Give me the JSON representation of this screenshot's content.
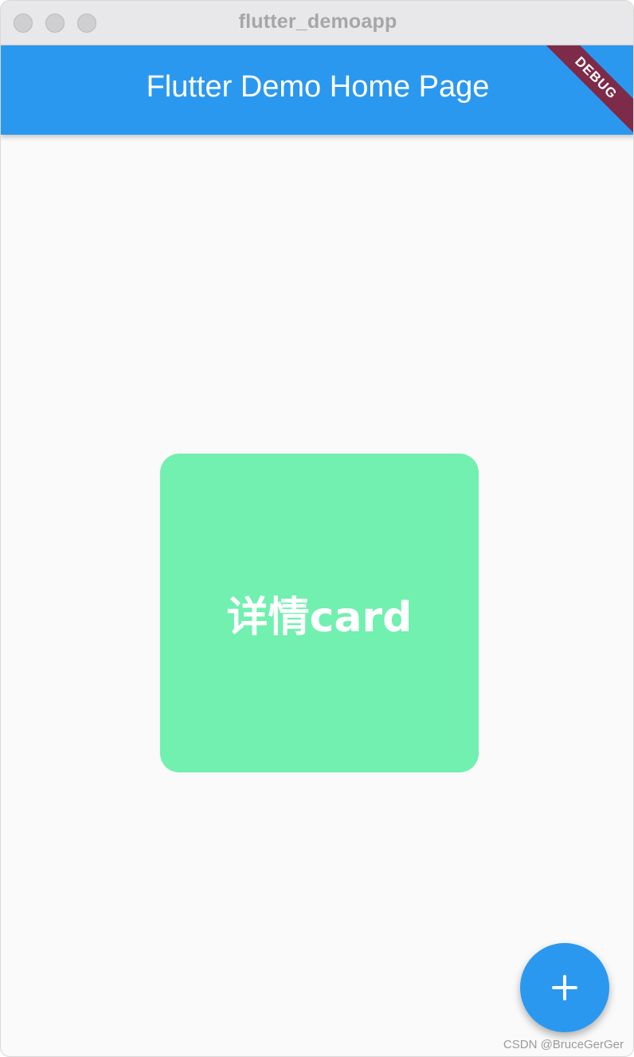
{
  "window": {
    "title": "flutter_demoapp"
  },
  "appbar": {
    "title": "Flutter Demo Home Page",
    "color": "#2b98ef",
    "debug_label": "DEBUG"
  },
  "card": {
    "text": "详情card",
    "color": "#71f0b0"
  },
  "fab": {
    "icon": "plus-icon",
    "color": "#2b98ef"
  },
  "watermark": {
    "text": "CSDN @BruceGerGer"
  }
}
